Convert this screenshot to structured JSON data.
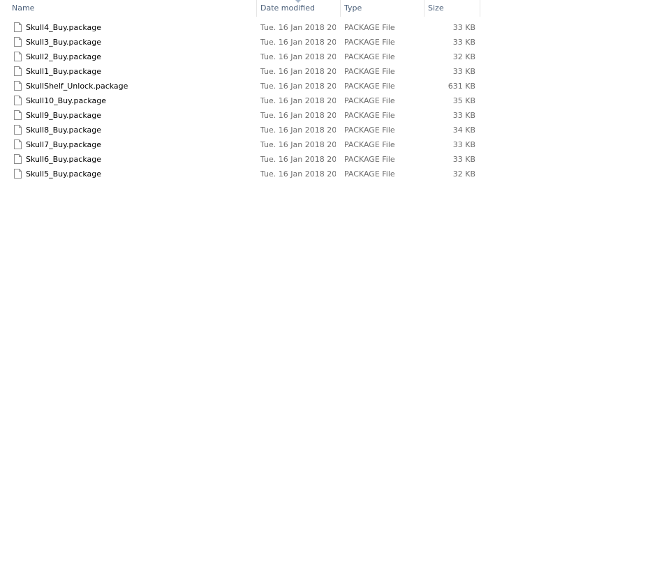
{
  "columns": {
    "name": "Name",
    "date": "Date modified",
    "type": "Type",
    "size": "Size"
  },
  "sort": {
    "column": "date",
    "icon": "sort-arrow-icon"
  },
  "icons": {
    "file": "file-icon"
  },
  "colors": {
    "header_text": "#4c607a",
    "secondary_text": "#6d6d6d",
    "background": "#ffffff"
  },
  "files": [
    {
      "name": "Skull4_Buy.package",
      "date": "Tue. 16 Jan 2018 20...",
      "type": "PACKAGE File",
      "size": "33 KB"
    },
    {
      "name": "Skull3_Buy.package",
      "date": "Tue. 16 Jan 2018 20...",
      "type": "PACKAGE File",
      "size": "33 KB"
    },
    {
      "name": "Skull2_Buy.package",
      "date": "Tue. 16 Jan 2018 20...",
      "type": "PACKAGE File",
      "size": "32 KB"
    },
    {
      "name": "Skull1_Buy.package",
      "date": "Tue. 16 Jan 2018 20...",
      "type": "PACKAGE File",
      "size": "33 KB"
    },
    {
      "name": "SkullShelf_Unlock.package",
      "date": "Tue. 16 Jan 2018 20...",
      "type": "PACKAGE File",
      "size": "631 KB"
    },
    {
      "name": "Skull10_Buy.package",
      "date": "Tue. 16 Jan 2018 20...",
      "type": "PACKAGE File",
      "size": "35 KB"
    },
    {
      "name": "Skull9_Buy.package",
      "date": "Tue. 16 Jan 2018 20...",
      "type": "PACKAGE File",
      "size": "33 KB"
    },
    {
      "name": "Skull8_Buy.package",
      "date": "Tue. 16 Jan 2018 20...",
      "type": "PACKAGE File",
      "size": "34 KB"
    },
    {
      "name": "Skull7_Buy.package",
      "date": "Tue. 16 Jan 2018 20...",
      "type": "PACKAGE File",
      "size": "33 KB"
    },
    {
      "name": "Skull6_Buy.package",
      "date": "Tue. 16 Jan 2018 20...",
      "type": "PACKAGE File",
      "size": "33 KB"
    },
    {
      "name": "Skull5_Buy.package",
      "date": "Tue. 16 Jan 2018 20...",
      "type": "PACKAGE File",
      "size": "32 KB"
    }
  ]
}
